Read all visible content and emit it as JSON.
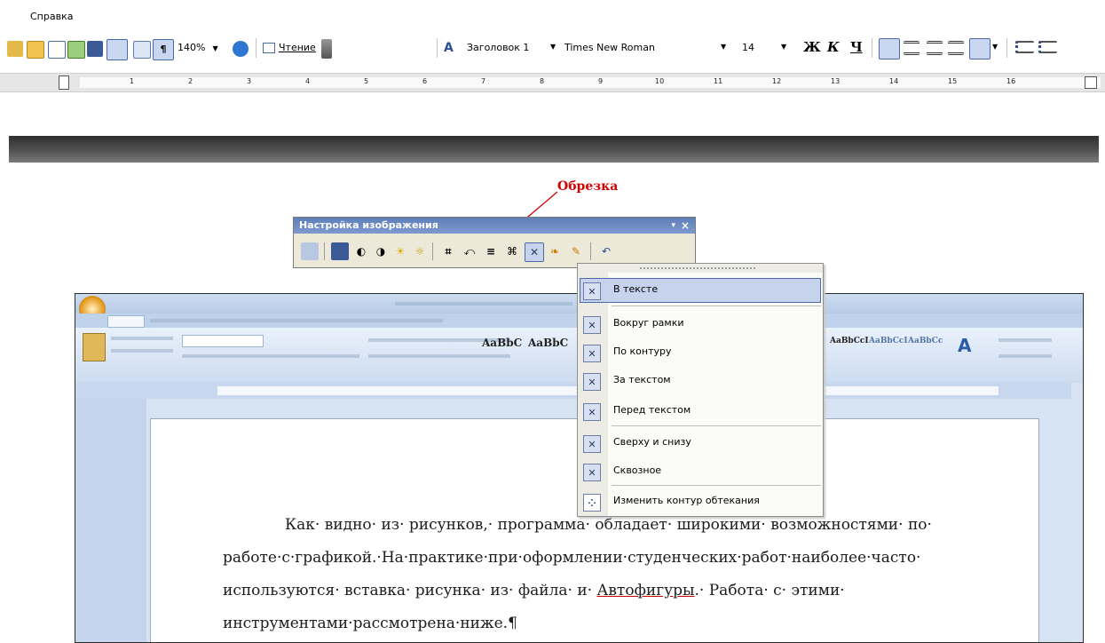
{
  "menubar": {
    "help_label": "Справка",
    "help_underline": "С"
  },
  "toolbar": {
    "zoom": "140%",
    "reading_label": "Чтение",
    "style": "Заголовок 1",
    "font": "Times New Roman",
    "font_size": "14",
    "bold": "Ж",
    "italic": "К",
    "underline": "Ч",
    "pilcrow": "¶"
  },
  "ruler": {
    "marks": [
      "1",
      "2",
      "3",
      "4",
      "5",
      "6",
      "7",
      "8",
      "9",
      "10",
      "11",
      "12",
      "13",
      "14",
      "15",
      "16"
    ]
  },
  "callout": {
    "label": "Обрезка"
  },
  "picture_toolbar": {
    "title": "Настройка изображения",
    "close_glyph": "×",
    "pin_glyph": "▾"
  },
  "wrap_menu": {
    "items": [
      {
        "label": "В тексте",
        "selected": true
      },
      {
        "label": "Вокруг рамки"
      },
      {
        "label": "По контуру"
      },
      {
        "label": "За текстом"
      },
      {
        "label": "Перед текстом"
      },
      {
        "label": "Сверху и снизу"
      },
      {
        "label": "Сквозное"
      },
      {
        "label": "Изменить контур обтекания"
      }
    ]
  },
  "word2007": {
    "style_samples": [
      "AaBbC",
      "AaBbC",
      "AaBbCcI",
      "AaBbCcI",
      "AaBbCc"
    ]
  },
  "document": {
    "line1": "Как· видно· из· рисунков,· программа· обладает· широкими· возможностями· по·",
    "line2": "работе·с·графикой.·На·практике·при·оформлении·студенческих·работ·наиболее·часто·",
    "line3_a": "используются·  вставка·  рисунка·  из·  файла·  и·  ",
    "line3_link": "Автофигуры",
    "line3_b": ".·  Работа·  с·  этими·",
    "line4": "инструментами·рассмотрена·ниже.¶"
  },
  "colors": {
    "callout": "#d40000",
    "picture_toolbar_title": "#6f8dc4",
    "selected_item": "#c7d3ec",
    "word2007_chrome": "#d6e3f3"
  }
}
